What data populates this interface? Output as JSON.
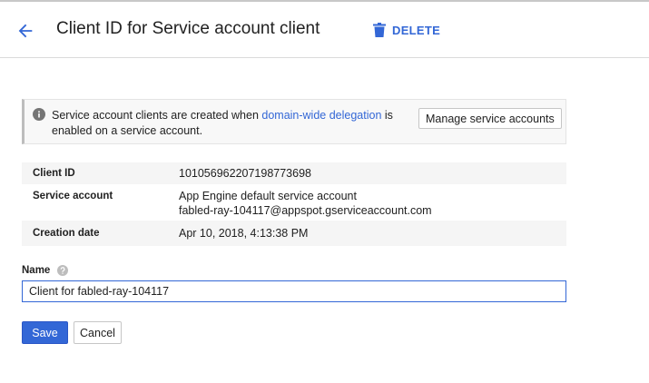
{
  "colors": {
    "accent": "#3367d6",
    "border": "#dadada",
    "shaded_row": "#f5f5f5"
  },
  "header": {
    "title": "Client ID for Service account client",
    "back_icon": "arrow-left-icon",
    "delete_icon": "trash-icon",
    "delete_label": "DELETE"
  },
  "info": {
    "icon": "info-icon",
    "text_before": "Service account clients are created when ",
    "link_text": "domain-wide delegation",
    "text_after": " is enabled on a service account.",
    "button_label": "Manage service accounts"
  },
  "details": {
    "client_id": {
      "label": "Client ID",
      "value": "101056962207198773698"
    },
    "service_account": {
      "label": "Service account",
      "value_line1": "App Engine default service account",
      "value_line2": "fabled-ray-104117@appspot.gserviceaccount.com"
    },
    "creation_date": {
      "label": "Creation date",
      "value": "Apr 10, 2018, 4:13:38 PM"
    }
  },
  "form": {
    "name_label": "Name",
    "help_icon": "help-icon",
    "name_value": "Client for fabled-ray-104117",
    "save_label": "Save",
    "cancel_label": "Cancel"
  }
}
